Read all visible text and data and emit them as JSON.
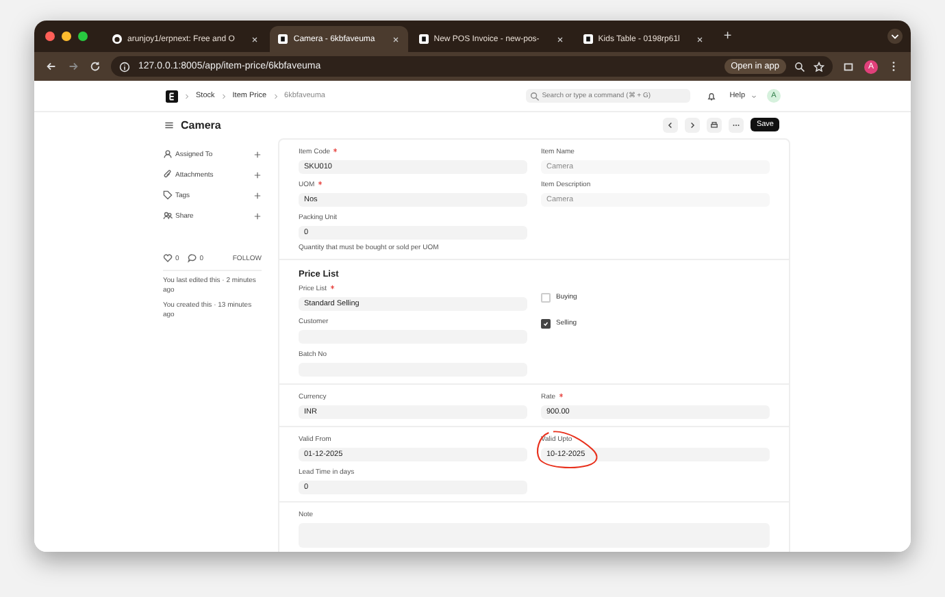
{
  "browser": {
    "tabs": [
      {
        "title": "arunjoy1/erpnext: Free and O",
        "selected": false
      },
      {
        "title": "Camera - 6kbfaveuma",
        "selected": true
      },
      {
        "title": "New POS Invoice - new-pos-",
        "selected": false
      },
      {
        "title": "Kids Table - 0198rp61l",
        "selected": false
      }
    ],
    "new_tab": "+",
    "url": "127.0.0.1:8005/app/item-price/6kbfaveuma",
    "open_in_app": "Open in app",
    "profile": "A"
  },
  "navbar": {
    "breadcrumbs": [
      "Stock",
      "Item Price",
      "6kbfaveuma"
    ],
    "search": {
      "placeholder": "Search or type a command (⌘ + G)"
    },
    "help": "Help",
    "avatar": "A"
  },
  "page": {
    "title": "Camera",
    "save": "Save"
  },
  "sidebar": {
    "items": [
      {
        "label": "Assigned To"
      },
      {
        "label": "Attachments"
      },
      {
        "label": "Tags"
      },
      {
        "label": "Share"
      }
    ],
    "likes": "0",
    "comments": "0",
    "follow": "FOLLOW",
    "activity": [
      "You last edited this · 2 minutes ago",
      "You created this · 13 minutes ago"
    ]
  },
  "sections": [
    {
      "columns": [
        [
          {
            "kind": "input",
            "label": "Item Code",
            "required": true,
            "value": "SKU010"
          },
          {
            "kind": "input",
            "label": "UOM",
            "required": true,
            "value": "Nos"
          },
          {
            "kind": "input",
            "label": "Packing Unit",
            "value": "0",
            "description": "Quantity that must be bought or sold per UOM"
          }
        ],
        [
          {
            "kind": "input",
            "label": "Item Name",
            "value": "Camera",
            "readonly": true
          },
          {
            "kind": "input",
            "label": "Item Description",
            "value": "Camera",
            "readonly": true
          }
        ]
      ]
    },
    {
      "title": "Price List",
      "columns": [
        [
          {
            "kind": "input",
            "label": "Price List",
            "required": true,
            "value": "Standard Selling"
          },
          {
            "kind": "input",
            "label": "Customer"
          },
          {
            "kind": "input",
            "label": "Batch No"
          }
        ],
        [
          {
            "kind": "check",
            "label": "Buying",
            "checked": false
          },
          {
            "kind": "check",
            "label": "Selling",
            "checked": true
          }
        ]
      ]
    },
    {
      "columns": [
        [
          {
            "kind": "input",
            "label": "Currency",
            "value": "INR"
          }
        ],
        [
          {
            "kind": "input",
            "label": "Rate",
            "required": true,
            "value": "900.00"
          }
        ]
      ]
    },
    {
      "columns": [
        [
          {
            "kind": "input",
            "label": "Valid From",
            "value": "01-12-2025"
          },
          {
            "kind": "input",
            "label": "Lead Time in days",
            "value": "0"
          }
        ],
        [
          {
            "kind": "input",
            "label": "Valid Upto",
            "value": "10-12-2025",
            "annotated": true
          }
        ]
      ]
    },
    {
      "columns": [
        [
          {
            "kind": "textarea",
            "label": "Note"
          }
        ]
      ]
    }
  ]
}
